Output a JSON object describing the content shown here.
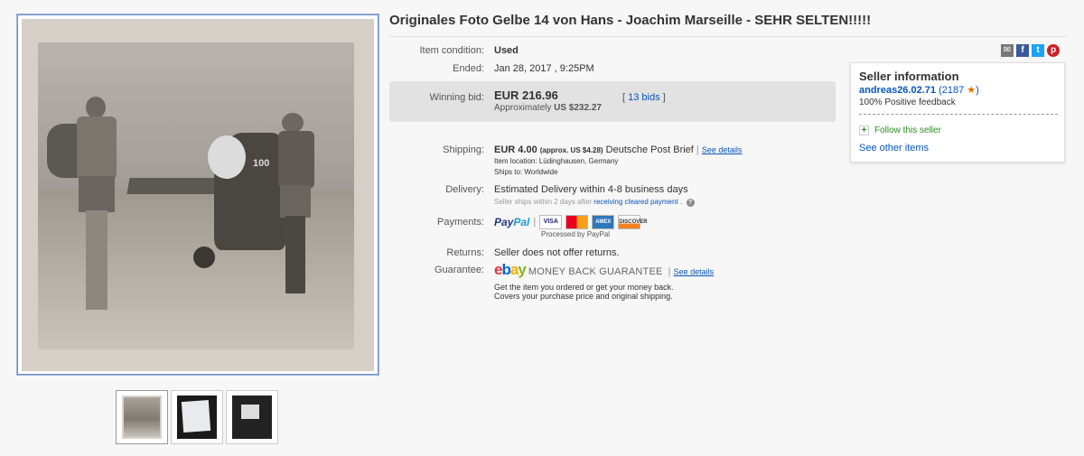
{
  "listing": {
    "title": "Originales Foto Gelbe 14 von Hans - Joachim Marseille - SEHR SELTEN!!!!!"
  },
  "details": {
    "condition_label": "Item condition:",
    "condition_value": "Used",
    "ended_label": "Ended:",
    "ended_value": "Jan 28, 2017 , 9:25PM",
    "winning_bid_label": "Winning bid:",
    "winning_bid_value": "EUR 216.96",
    "approx_label": "Approximately",
    "approx_value": "US $232.27",
    "bids_link": "13 bids",
    "shipping_label": "Shipping:",
    "shipping_value": "EUR 4.00",
    "shipping_approx": "(approx. US $4.28)",
    "shipping_service": "Deutsche Post Brief",
    "shipping_details_link": "See details",
    "item_location": "Item location:   Lüdinghausen, Germany",
    "ships_to": "Ships to:   Worldwide",
    "delivery_label": "Delivery:",
    "delivery_value": "Estimated Delivery within 4-8 business days",
    "delivery_note": "Seller ships within 2 days after",
    "delivery_note_link": "receiving cleared payment",
    "payments_label": "Payments:",
    "paypal_pay": "Pay",
    "paypal_pal": "Pal",
    "processed_by": "Processed by PayPal",
    "cards": [
      "VISA",
      "",
      "AMEX",
      "DISCOVER"
    ],
    "returns_label": "Returns:",
    "returns_value": "Seller does not offer returns.",
    "guarantee_label": "Guarantee:",
    "mbg_text": "MONEY BACK GUARANTEE",
    "guarantee_details_link": "See details",
    "guarantee_line1": "Get the item you ordered or get your money back.",
    "guarantee_line2": "Covers your purchase price and original shipping."
  },
  "seller": {
    "title": "Seller information",
    "name": "andreas26.02.71",
    "feedback_score": "2187",
    "positive": "100% Positive feedback",
    "follow": "Follow this seller",
    "other_items": "See other items"
  },
  "photo": {
    "stamp_number": "100"
  },
  "thumbnails": [
    "thumb-1",
    "thumb-2",
    "thumb-3"
  ],
  "colors": {
    "link": "#0654ba",
    "bid_bg": "#e2e2e2",
    "star": "#e46c00"
  }
}
